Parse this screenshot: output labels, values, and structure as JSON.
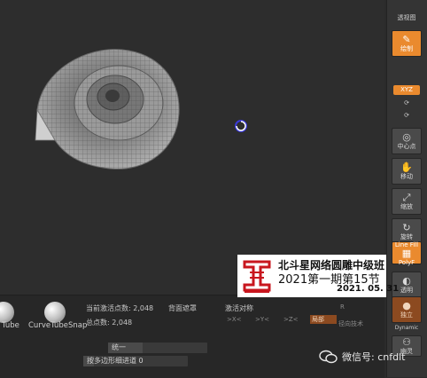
{
  "shelf": {
    "top_label": "透视图",
    "btn_draw": "绘制",
    "xyz": "XYZ",
    "btn_local": "中心点",
    "btn_move": "移动",
    "btn_scale": "缩放",
    "btn_rotate": "旋转",
    "btn_polyf": "PolyF",
    "polyf_top": "Line Fill",
    "btn_transp": "透明",
    "btn_solo": "独立",
    "dynamic_label": "Dynamic",
    "btn_ghost": "幽灵"
  },
  "brushes": {
    "brush1": "Tube",
    "brush2": "CurveTubeSnap"
  },
  "stats": {
    "active_points": "当前激活点数: 2,048",
    "total_points": "总点数: 2,048",
    "backface_mask": "背面遮罩",
    "activate_symmetry": "激活对称",
    "axis_x": ">X<",
    "axis_y": ">Y<",
    "axis_z": ">Z<",
    "radial": "R",
    "local_sym": "局部",
    "radial_count": "径向技术",
    "unify": "统一",
    "poly_slider": "按多边形细进道 0"
  },
  "badge": {
    "line1": "北斗星网络圆雕中级班",
    "line2": "2021第一期第15节",
    "line3": "2021. 05. 31"
  },
  "wechat": {
    "text": "微信号: cnfdlt"
  },
  "colors": {
    "accent": "#ea8a2e",
    "viewport": "#2d2d2d",
    "panel": "#272727"
  }
}
